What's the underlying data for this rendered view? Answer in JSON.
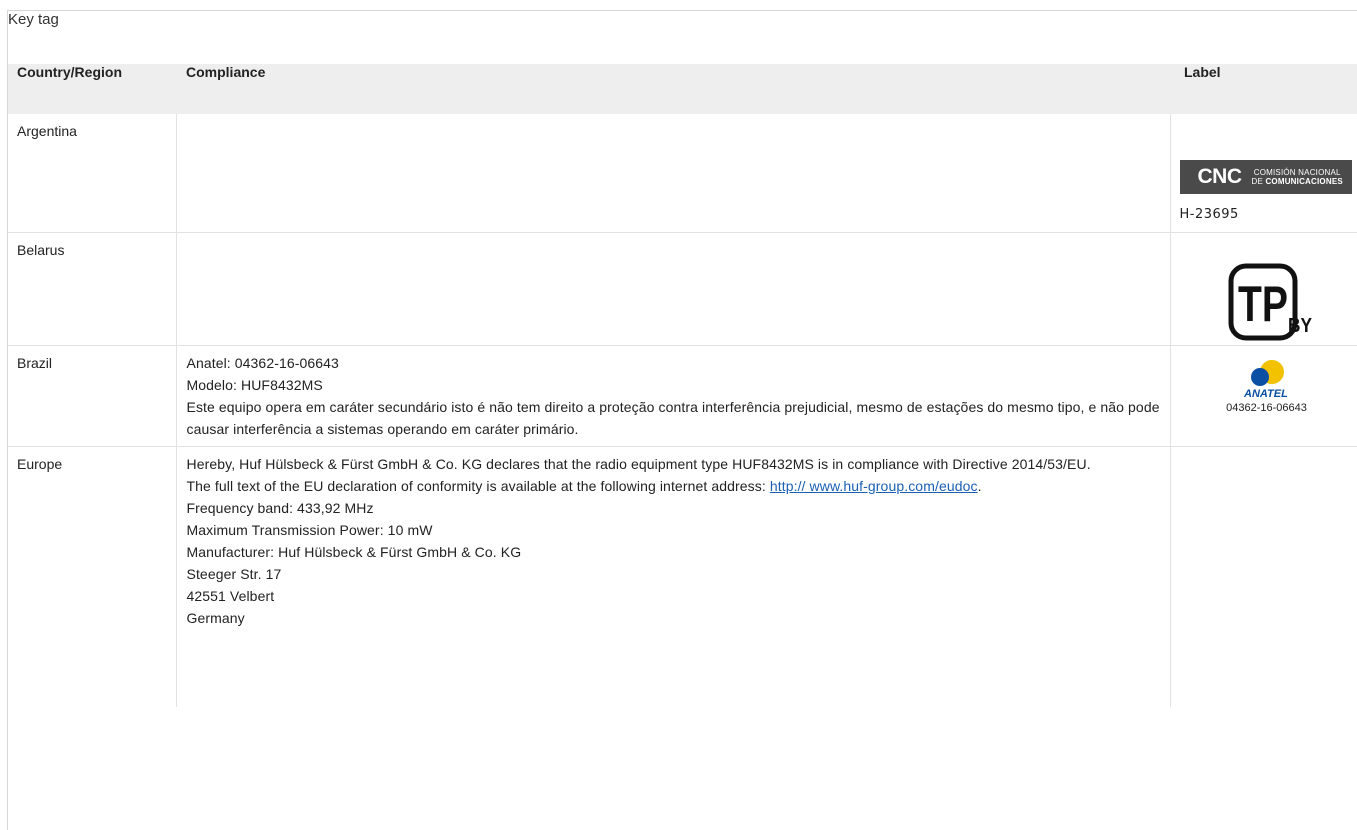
{
  "table": {
    "caption": "Key tag",
    "headers": {
      "country": "Country/Region",
      "compliance": "Compliance",
      "label": "Label"
    },
    "rows": [
      {
        "country": "Argentina",
        "label": {
          "logo_text_big": "CNC",
          "logo_text_small_1": "COMISIÓN NACIONAL",
          "logo_text_small_2_a": "DE ",
          "logo_text_small_2_b": "COMUNICACIONES",
          "id": "H-23695"
        }
      },
      {
        "country": "Belarus",
        "label": {
          "logo_text_main": "TP",
          "logo_text_sub": "BY"
        }
      },
      {
        "country": "Brazil",
        "compliance": [
          "Anatel: 04362-16-06643",
          "Modelo: HUF8432MS",
          "Este equipo opera em caráter secundário isto é não tem direito a proteção contra interferência prejudicial, mesmo de estações do mesmo tipo, e não pode causar interferência a sistemas operando em caráter primário."
        ],
        "label": {
          "logo_text": "ANATEL",
          "id": "04362-16-06643"
        }
      },
      {
        "country": "Europe",
        "compliance": {
          "line1": "Hereby, Huf Hülsbeck & Fürst GmbH & Co. KG declares that the radio equipment type HUF8432MS is in compliance with Directive 2014/53/EU.",
          "line2_prefix": "The full text of the EU declaration of conformity is available at the following internet address: ",
          "line2_link": "http:// www.huf-group.com/eudoc",
          "line2_suffix": ".",
          "lines_after": [
            "Frequency band: 433,92 MHz",
            "Maximum Transmission Power: 10 mW",
            "Manufacturer: Huf Hülsbeck & Fürst GmbH & Co. KG",
            "Steeger Str. 17",
            "42551 Velbert",
            "Germany"
          ]
        }
      }
    ]
  },
  "colors": {
    "header_bg": "#eeeeee",
    "border": "#e2e2e2",
    "link": "#1a5fb4",
    "cnc_bg": "#4a4a4a",
    "anatel_blue": "#0a4fa3",
    "anatel_yellow": "#f2c200"
  }
}
